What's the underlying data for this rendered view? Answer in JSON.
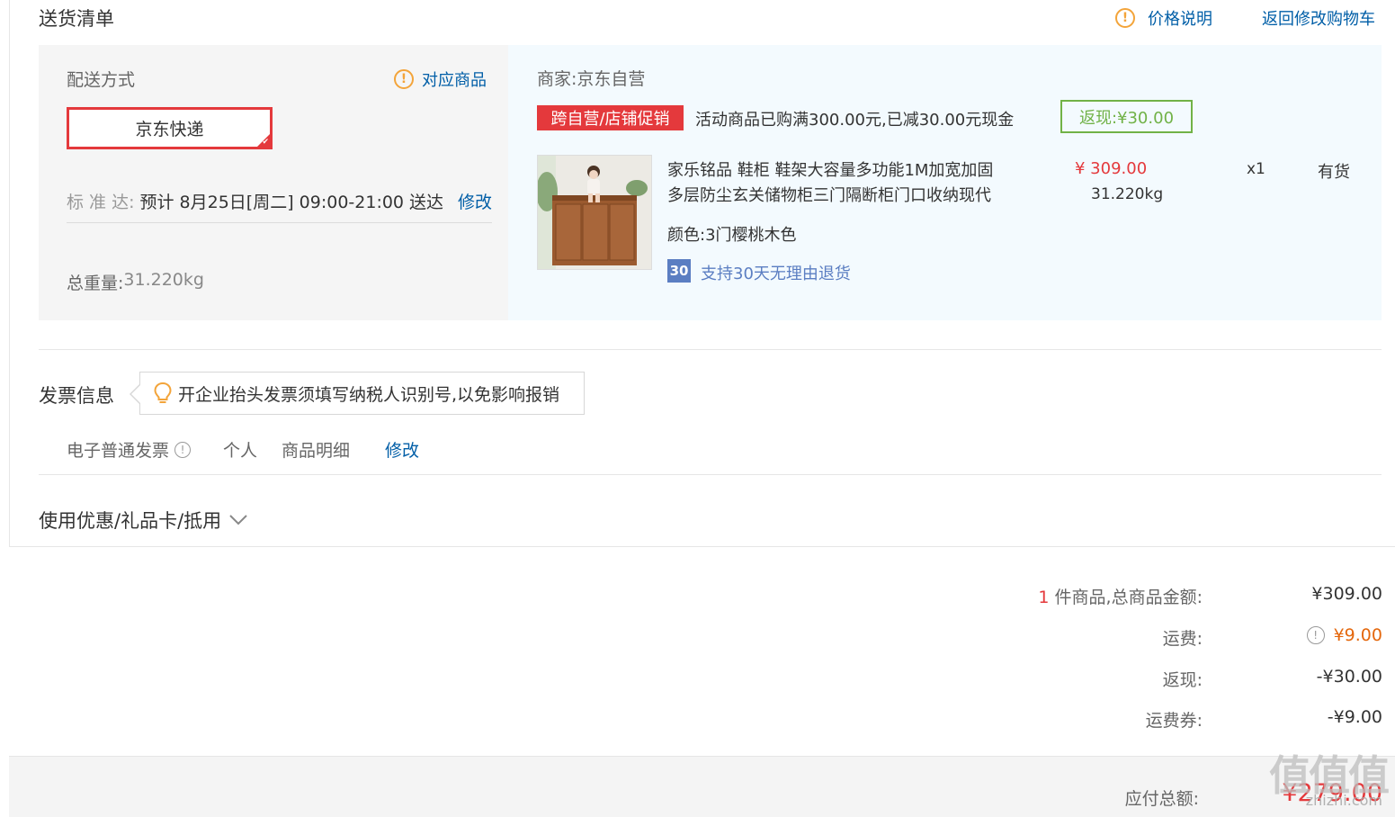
{
  "header": {
    "title": "送货清单",
    "price_note": "价格说明",
    "back_to_cart": "返回修改购物车"
  },
  "shipping": {
    "method_label": "配送方式",
    "matching_items": "对应商品",
    "method_selected": "京东快递",
    "standard_label": "标 准 达:",
    "eta": "预计 8月25日[周二] 09:00-21:00 送达",
    "modify": "修改",
    "total_weight_label": "总重量:",
    "total_weight": "31.220kg"
  },
  "store": {
    "merchant": "商家:京东自营",
    "promo_tag": "跨自营/店铺促销",
    "promo_text": "活动商品已购满300.00元,已减30.00元现金",
    "rebate": "返现:¥30.00"
  },
  "product": {
    "title_line1": "家乐铭品 鞋柜 鞋架大容量多功能1M加宽加固",
    "title_line2": "多层防尘玄关储物柜三门隔断柜门口收纳现代",
    "price": "¥ 309.00",
    "weight": "31.220kg",
    "quantity": "x1",
    "stock": "有货",
    "color": "颜色:3门樱桃木色",
    "return_badge": "30",
    "return_policy": "支持30天无理由退货"
  },
  "invoice": {
    "title": "发票信息",
    "tip": "开企业抬头发票须填写纳税人识别号,以免影响报销",
    "type": "电子普通发票",
    "holder": "个人",
    "content": "商品明细",
    "modify": "修改"
  },
  "coupon": {
    "label": "使用优惠/礼品卡/抵用"
  },
  "summary": {
    "item_count": "1",
    "item_label": "件商品,总商品金额:",
    "goods_total": "¥309.00",
    "shipping_label": "运费:",
    "shipping_fee": "¥9.00",
    "rebate_label": "返现:",
    "rebate_value": "-¥30.00",
    "voucher_label": "运费券:",
    "voucher_value": "-¥9.00",
    "payable_label": "应付总额:",
    "payable_value": "¥279.00"
  },
  "watermark": {
    "text": "值值值",
    "url": "zhizhi.com"
  },
  "colors": {
    "accent_red": "#e4393c",
    "link_blue": "#005ea7",
    "rebate_green": "#71b247",
    "warn_orange": "#f3a43a",
    "shipping_fee_orange": "#e4670c"
  }
}
